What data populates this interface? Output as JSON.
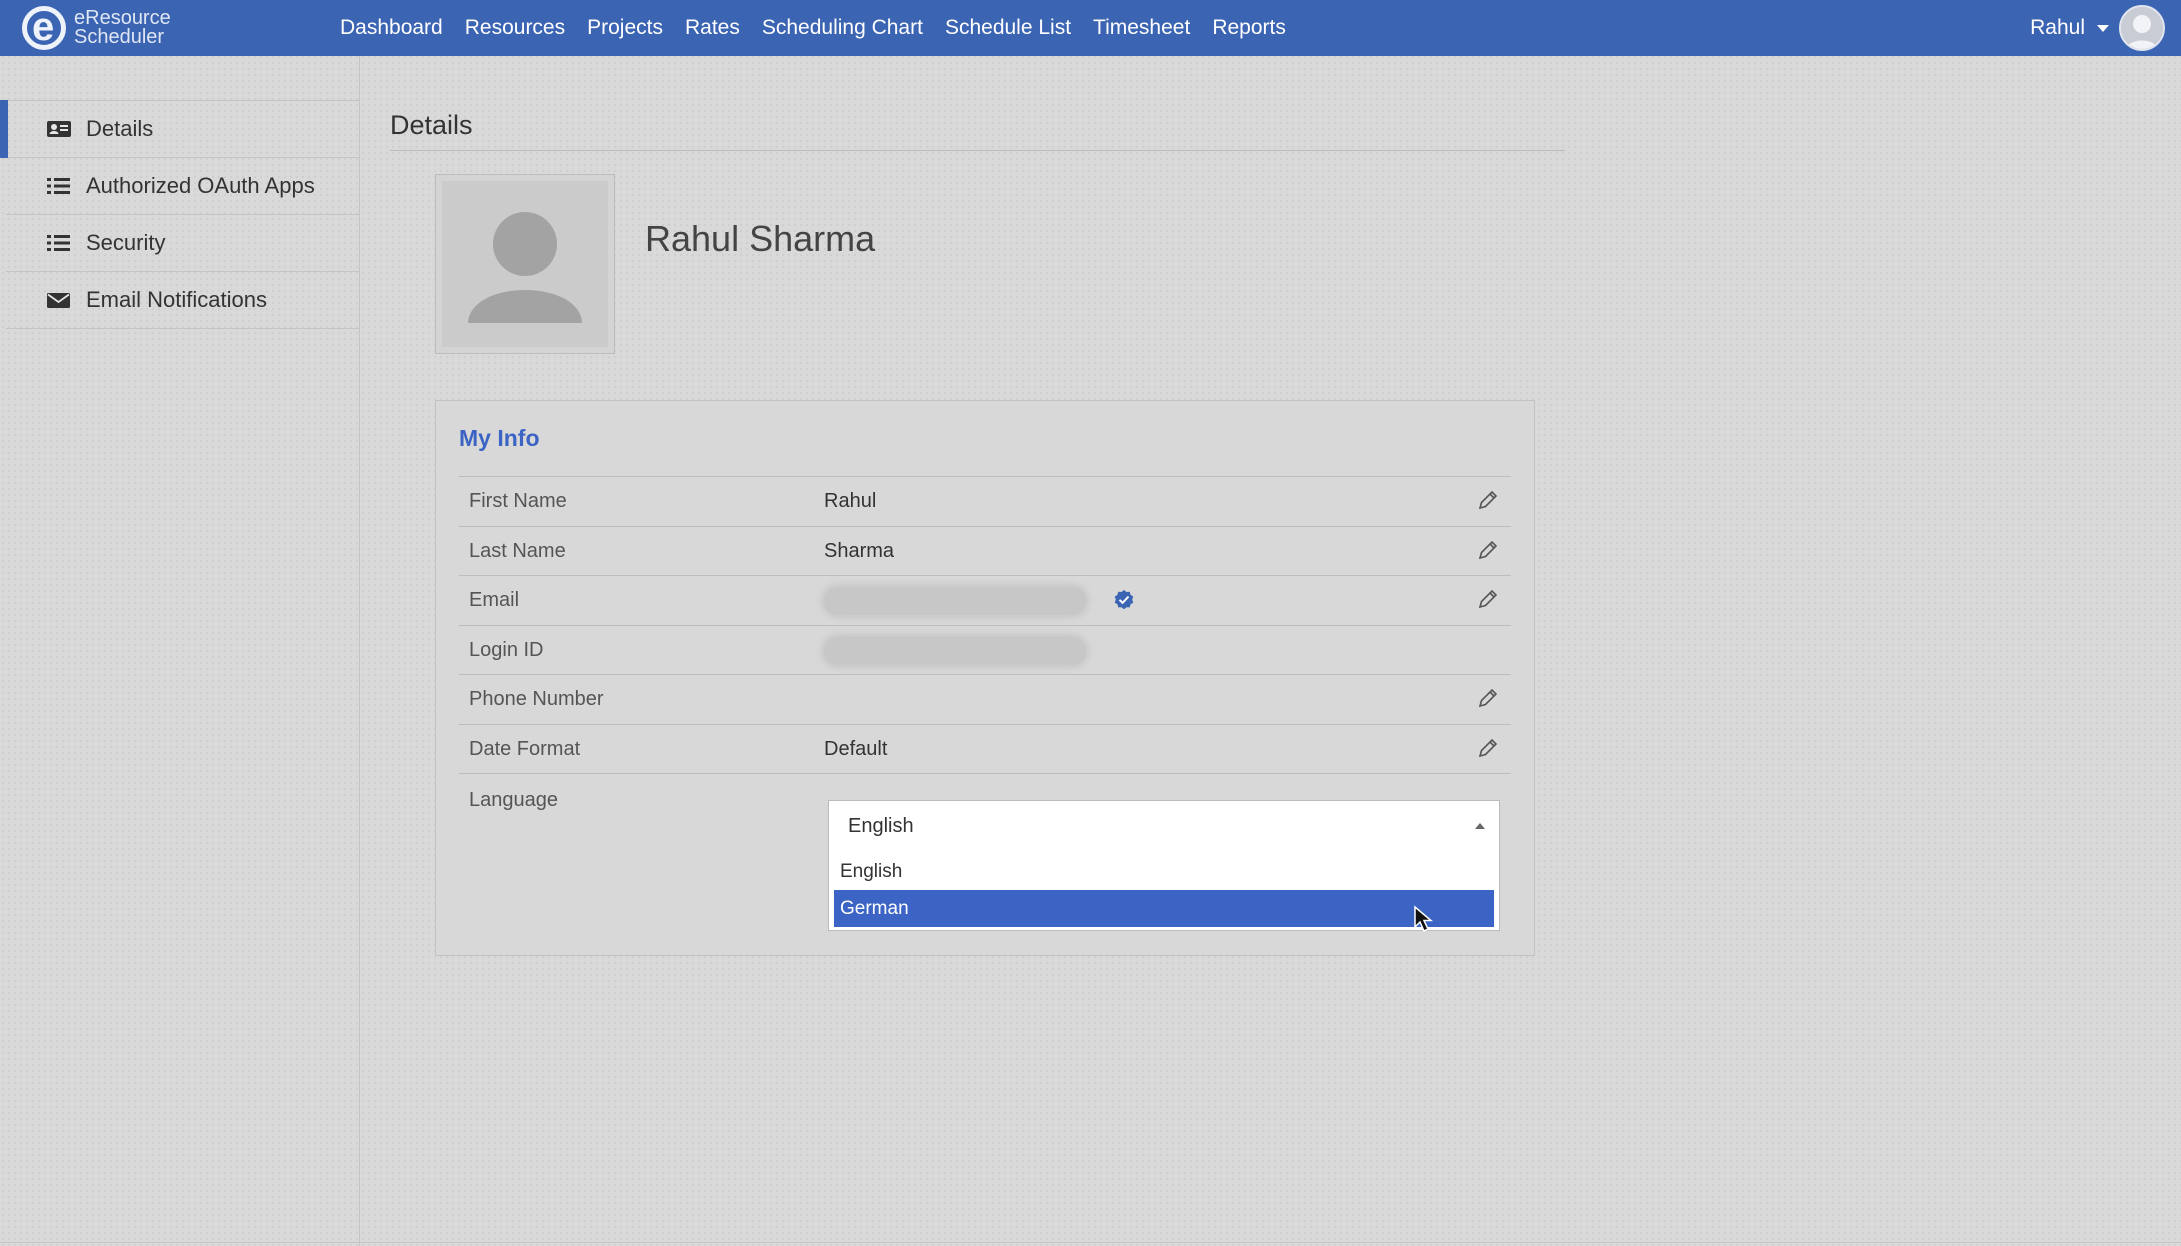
{
  "app": {
    "logo_line1": "eResource",
    "logo_line2": "Scheduler"
  },
  "nav": {
    "items": [
      "Dashboard",
      "Resources",
      "Projects",
      "Rates",
      "Scheduling Chart",
      "Schedule List",
      "Timesheet",
      "Reports"
    ],
    "user_name": "Rahul"
  },
  "sidebar": {
    "items": [
      {
        "label": "Details",
        "icon": "id-card-icon",
        "active": true
      },
      {
        "label": "Authorized OAuth Apps",
        "icon": "list-icon"
      },
      {
        "label": "Security",
        "icon": "list-icon"
      },
      {
        "label": "Email Notifications",
        "icon": "envelope-icon"
      }
    ]
  },
  "main": {
    "title": "Details",
    "profile_name": "Rahul Sharma"
  },
  "my_info": {
    "title": "My Info",
    "rows": [
      {
        "label": "First Name",
        "value": "Rahul"
      },
      {
        "label": "Last Name",
        "value": "Sharma"
      },
      {
        "label": "Email",
        "value": ""
      },
      {
        "label": "Login ID",
        "value": ""
      },
      {
        "label": "Phone Number",
        "value": ""
      },
      {
        "label": "Date Format",
        "value": "Default"
      }
    ],
    "language_label": "Language",
    "language_selected": "English",
    "language_options": [
      "English",
      "German"
    ],
    "highlighted_option": "German"
  },
  "colors": {
    "nav_bg": "#3b64b3",
    "accent": "#3b64c4",
    "page_bg": "#d9d9d9"
  }
}
